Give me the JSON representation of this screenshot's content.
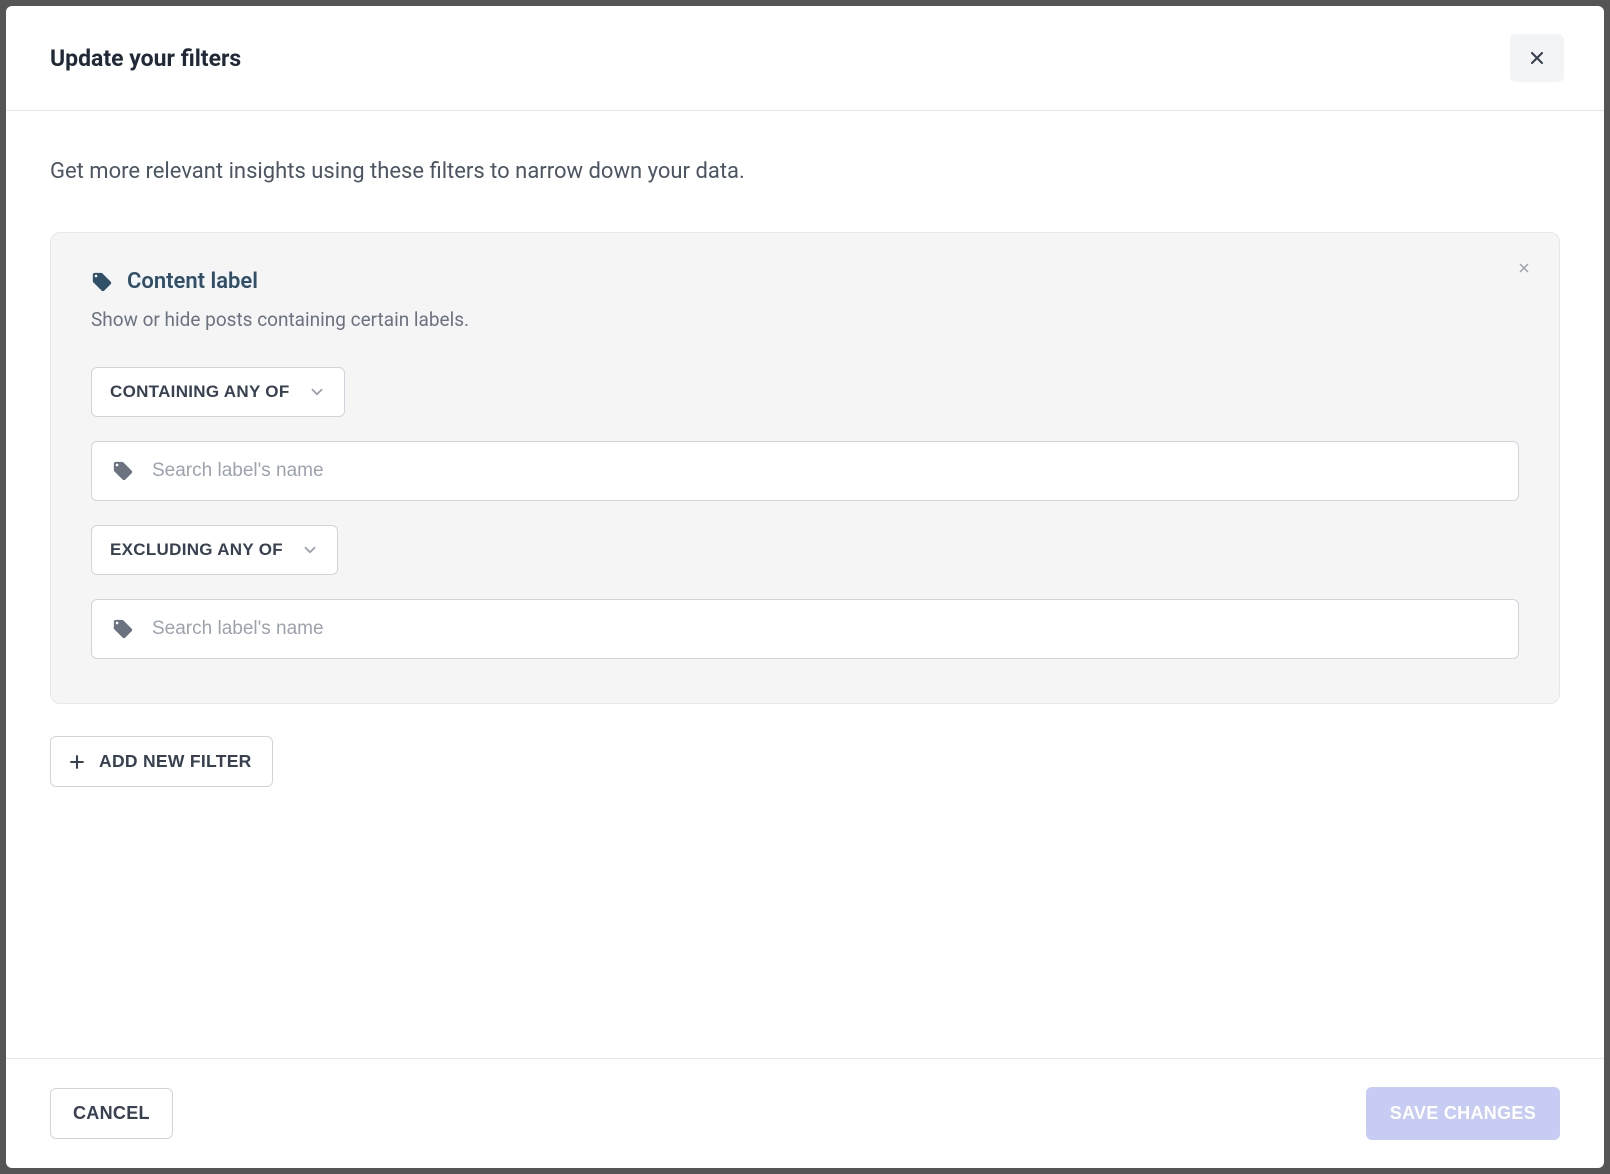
{
  "modal": {
    "title": "Update your filters",
    "description": "Get more relevant insights using these filters to narrow down your data."
  },
  "filter": {
    "title": "Content label",
    "subtitle": "Show or hide posts containing certain labels.",
    "containing": {
      "label": "CONTAINING ANY OF",
      "placeholder": "Search label's name"
    },
    "excluding": {
      "label": "EXCLUDING ANY OF",
      "placeholder": "Search label's name"
    }
  },
  "buttons": {
    "addFilter": "ADD NEW FILTER",
    "cancel": "CANCEL",
    "save": "SAVE CHANGES"
  }
}
